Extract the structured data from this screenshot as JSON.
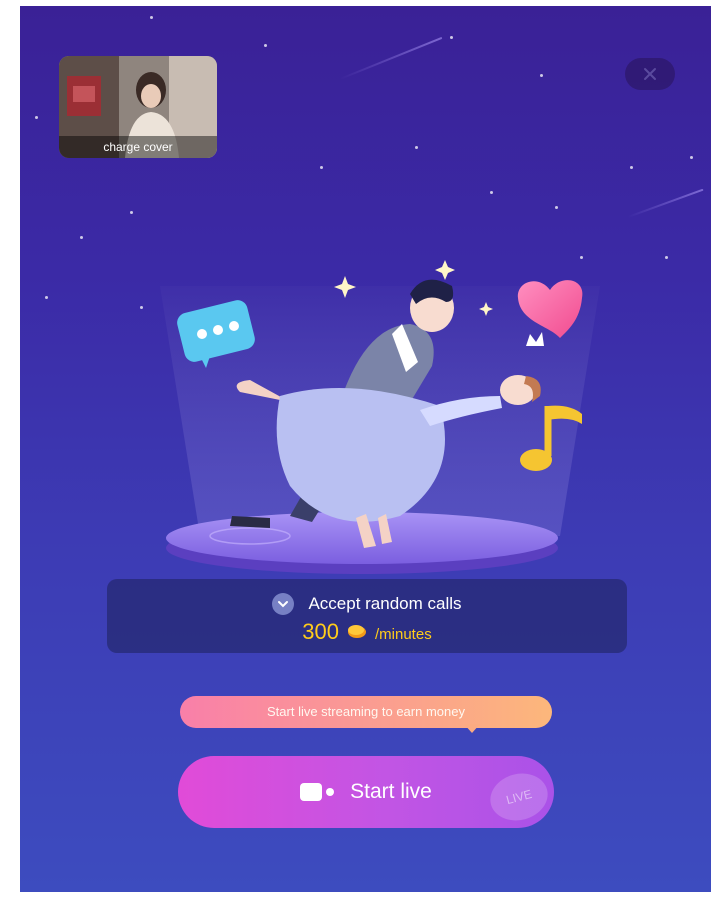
{
  "cover": {
    "caption": "charge cover"
  },
  "icons": {
    "close": "close-icon",
    "check": "chevron-down-icon",
    "coin": "coin-icon",
    "camera": "video-camera-icon"
  },
  "random_calls": {
    "label": "Accept random calls",
    "price": "300",
    "unit": "/minutes"
  },
  "hint": {
    "text": "Start live streaming to earn money"
  },
  "start_live": {
    "label": "Start live",
    "watermark": "LIVE"
  },
  "colors": {
    "bg_top": "#3a2196",
    "bg_bottom": "#3d4cbf",
    "price": "#ffcc1a",
    "button_start": "#e14bd8",
    "button_end": "#aa52e8"
  }
}
